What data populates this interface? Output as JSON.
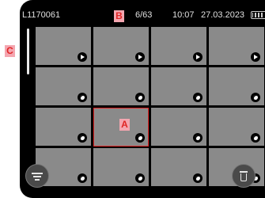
{
  "status_bar": {
    "file_name": "L1170061",
    "frame_counter": "6/63",
    "time": "10:07",
    "date": "27.03.2023",
    "battery_icon": "battery-icon"
  },
  "thumbnails": [
    {
      "badge": "play-icon"
    },
    {
      "badge": "play-icon"
    },
    {
      "badge": "play-icon"
    },
    {
      "badge": "play-icon"
    },
    {
      "badge": "lens-icon"
    },
    {
      "badge": "lens-icon"
    },
    {
      "badge": "lens-icon"
    },
    {
      "badge": "lens-icon"
    },
    {
      "badge": "lens-icon"
    },
    {
      "badge": "lens-icon",
      "selected": true
    },
    {
      "badge": "lens-icon"
    },
    {
      "badge": "lens-icon"
    },
    {
      "badge": "lens-icon"
    },
    {
      "badge": "lens-icon"
    },
    {
      "badge": "lens-icon"
    },
    {
      "badge": "lens-icon"
    }
  ],
  "buttons": {
    "filter": "filter-icon",
    "delete": "trash-icon"
  },
  "callouts": {
    "a": "A",
    "b": "B",
    "c": "C"
  },
  "colors": {
    "selection": "#e02525",
    "callout_bg": "#f4a6b0",
    "thumbnail": "#8a8a8a"
  }
}
